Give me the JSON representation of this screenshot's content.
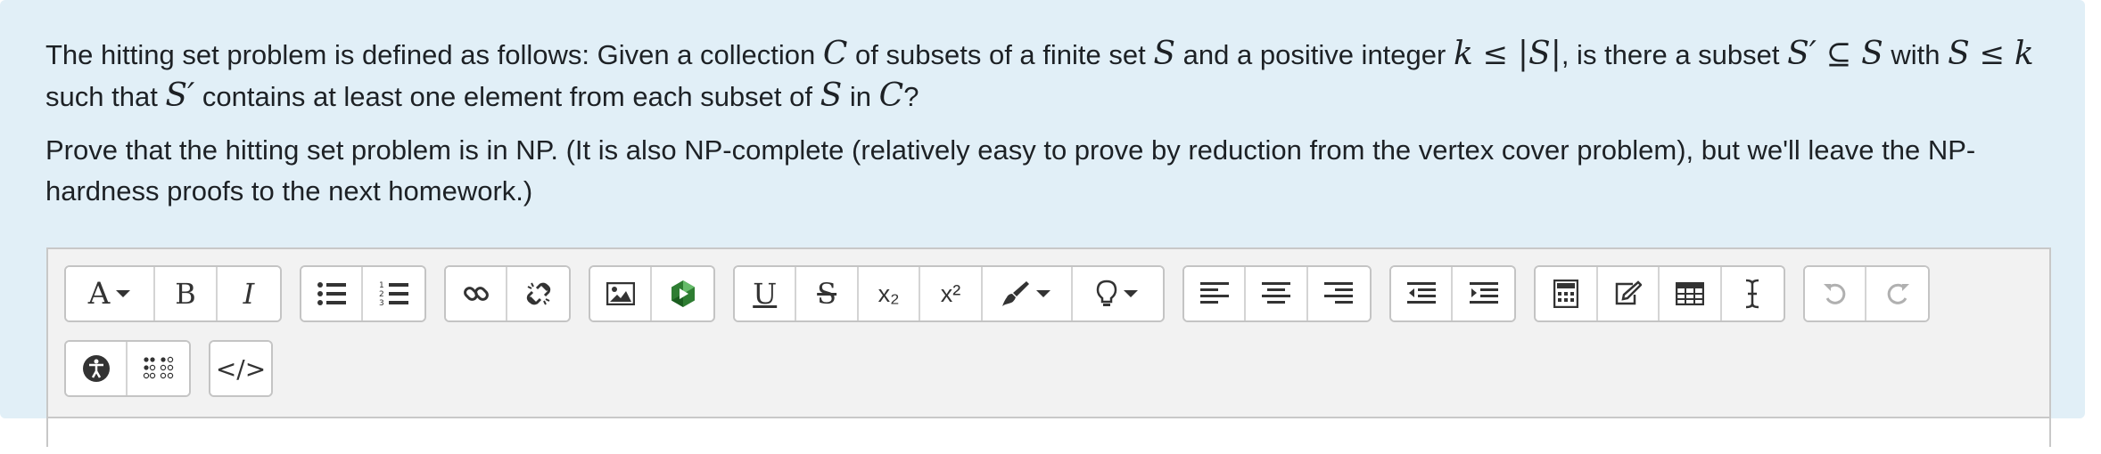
{
  "question": {
    "p1": {
      "t1": "The hitting set problem is defined as follows: Given a collection ",
      "C": "C",
      "t2": " of subsets of a finite set ",
      "S": "S",
      "t3": " and a positive integer ",
      "k": "k",
      "le": " ≤ ",
      "abs": "|S|",
      "t4": ", is there a subset ",
      "Sp": "S′",
      "sub": " ⊆ ",
      "S2": "S",
      "t5": " with ",
      "S3": "S",
      "le2": " ≤ ",
      "k2": "k",
      "t6": "such that ",
      "Sp2": "S′",
      "t7": " contains at least one element from each subset of ",
      "S4": "S",
      "t8": " in ",
      "C2": "C",
      "t9": "?"
    },
    "p2": "Prove that the hitting set problem is in NP. (It is also NP-complete (relatively easy to prove by reduction from the vertex cover problem), but we'll leave the NP-hardness proofs to the next homework.)"
  },
  "toolbar": {
    "font_button": "A",
    "bold": "B",
    "italic": "I",
    "underline": "U",
    "strike": "S",
    "subscript": "x₂",
    "superscript": "x²",
    "code": "</>",
    "icons": [
      "font-size-icon",
      "bold-icon",
      "italic-icon",
      "unordered-list-icon",
      "ordered-list-icon",
      "link-icon",
      "unlink-icon",
      "image-icon",
      "media-icon",
      "underline-icon",
      "strikethrough-icon",
      "subscript-icon",
      "superscript-icon",
      "text-color-icon",
      "bulb-icon",
      "align-left-icon",
      "align-center-icon",
      "align-right-icon",
      "outdent-icon",
      "indent-icon",
      "equation-icon",
      "edit-icon",
      "table-icon",
      "text-cursor-icon",
      "undo-icon",
      "redo-icon",
      "accessibility-icon",
      "braille-icon",
      "html-code-icon"
    ]
  }
}
